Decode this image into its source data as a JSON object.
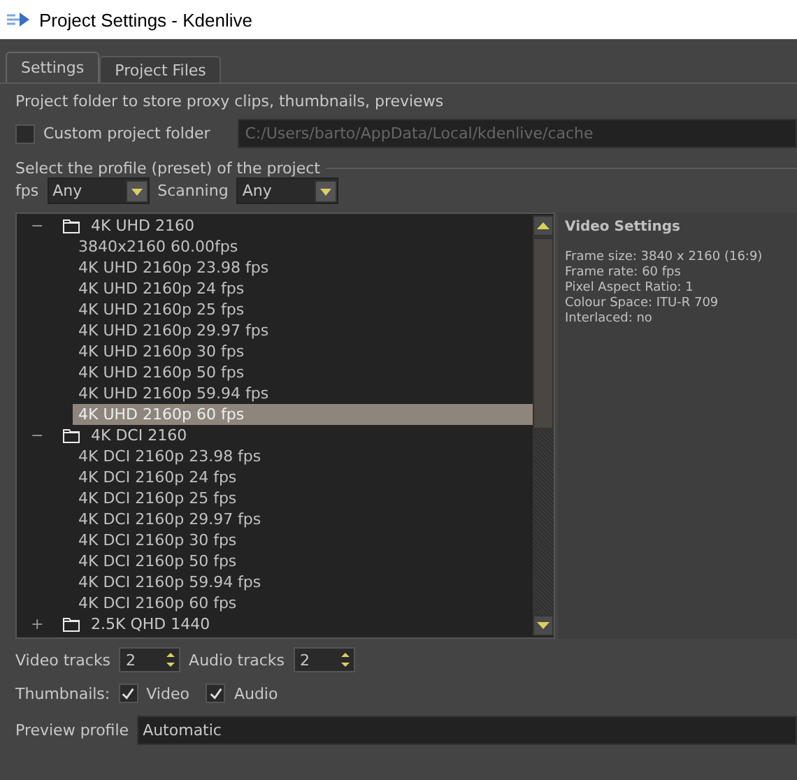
{
  "window": {
    "title": "Project Settings - Kdenlive"
  },
  "tabs": [
    {
      "label": "Settings",
      "selected": true
    },
    {
      "label": "Project Files",
      "selected": false
    }
  ],
  "proxy": {
    "description": "Project folder to store proxy clips, thumbnails, previews",
    "custom_folder": {
      "label": "Custom project folder",
      "checked": false
    },
    "folder_path": "C:/Users/barto/AppData/Local/kdenlive/cache"
  },
  "profile": {
    "legend": "Select the profile (preset) of the project",
    "fps_label": "fps",
    "fps_value": "Any",
    "scanning_label": "Scanning",
    "scanning_value": "Any",
    "tree": [
      {
        "label": "4K UHD 2160",
        "expanded": true,
        "children": [
          {
            "label": "3840x2160 60.00fps",
            "selected": false
          },
          {
            "label": "4K UHD 2160p 23.98 fps",
            "selected": false
          },
          {
            "label": "4K UHD 2160p 24 fps",
            "selected": false
          },
          {
            "label": "4K UHD 2160p 25 fps",
            "selected": false
          },
          {
            "label": "4K UHD 2160p 29.97 fps",
            "selected": false
          },
          {
            "label": "4K UHD 2160p 30 fps",
            "selected": false
          },
          {
            "label": "4K UHD 2160p 50 fps",
            "selected": false
          },
          {
            "label": "4K UHD 2160p 59.94 fps",
            "selected": false
          },
          {
            "label": "4K UHD 2160p 60 fps",
            "selected": true
          }
        ]
      },
      {
        "label": "4K DCI 2160",
        "expanded": true,
        "children": [
          {
            "label": "4K DCI 2160p 23.98 fps",
            "selected": false
          },
          {
            "label": "4K DCI 2160p 24 fps",
            "selected": false
          },
          {
            "label": "4K DCI 2160p 25 fps",
            "selected": false
          },
          {
            "label": "4K DCI 2160p 29.97 fps",
            "selected": false
          },
          {
            "label": "4K DCI 2160p 30 fps",
            "selected": false
          },
          {
            "label": "4K DCI 2160p 50 fps",
            "selected": false
          },
          {
            "label": "4K DCI 2160p 59.94 fps",
            "selected": false
          },
          {
            "label": "4K DCI 2160p 60 fps",
            "selected": false
          }
        ]
      },
      {
        "label": "2.5K QHD 1440",
        "expanded": false
      }
    ],
    "expand_signs": {
      "expanded": "−",
      "collapsed": "+"
    },
    "video_settings": {
      "title": "Video Settings",
      "lines": [
        "Frame size: 3840 x 2160 (16:9)",
        "Frame rate: 60 fps",
        "Pixel Aspect Ratio: 1",
        "Colour Space: ITU-R 709",
        "Interlaced: no"
      ]
    }
  },
  "tracks": {
    "video_label": "Video tracks",
    "video_value": "2",
    "audio_label": "Audio tracks",
    "audio_value": "2"
  },
  "thumbnails": {
    "label": "Thumbnails:",
    "options": [
      {
        "label": "Video",
        "checked": true
      },
      {
        "label": "Audio",
        "checked": true
      }
    ]
  },
  "preview_profile": {
    "label": "Preview profile",
    "value": "Automatic"
  }
}
